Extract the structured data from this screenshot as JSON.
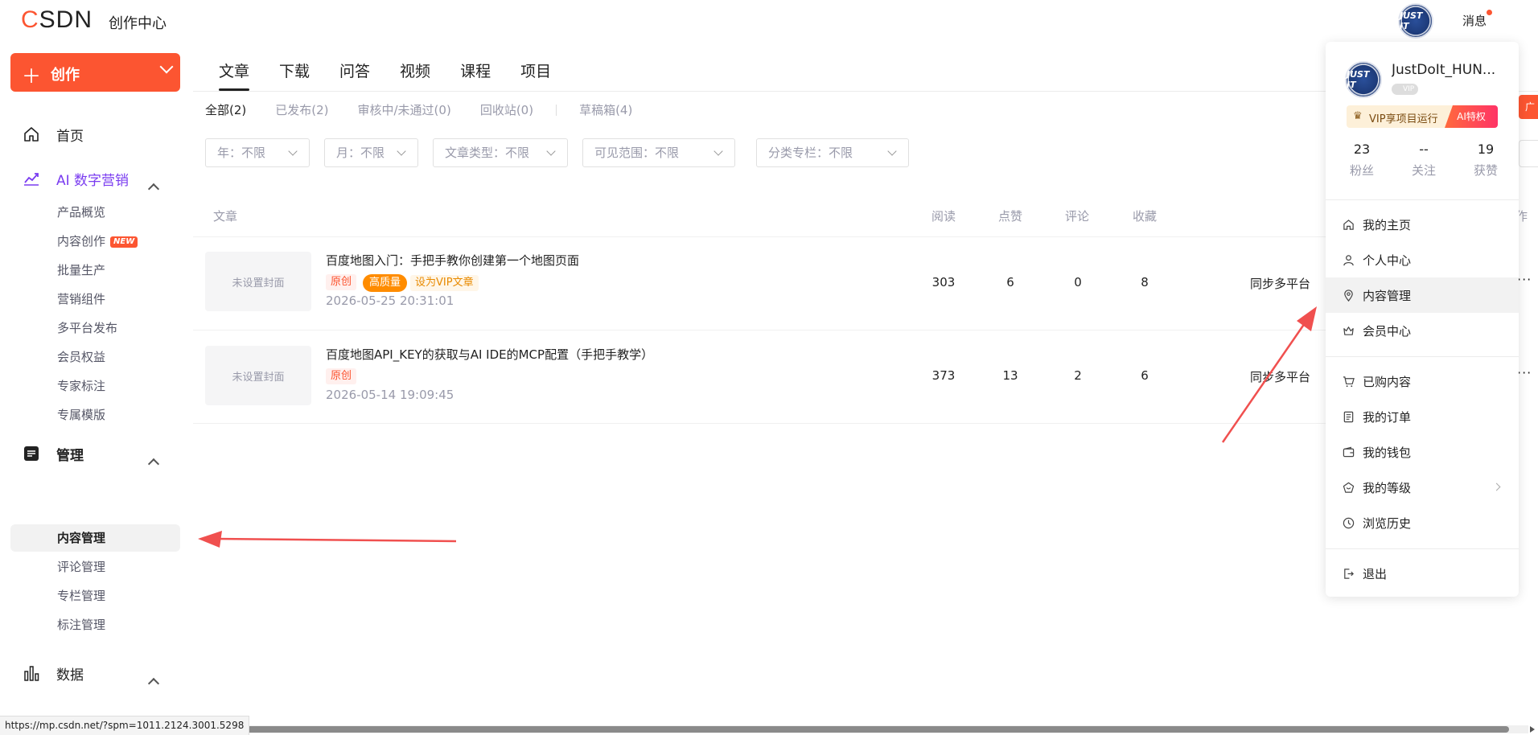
{
  "header": {
    "logo_prefix": "C",
    "logo_rest": "SDN",
    "title": "创作中心",
    "messages_label": "消息",
    "avatar_text": "JUST IT"
  },
  "sidebar": {
    "create_label": "创作",
    "home_label": "首页",
    "ai_group_label": "AI 数字营销",
    "ai_items": [
      "产品概览",
      "内容创作",
      "批量生产",
      "营销组件",
      "多平台发布",
      "会员权益",
      "专家标注",
      "专属模版"
    ],
    "new_badge": "NEW",
    "manage_group_label": "管理",
    "manage_items": [
      "内容管理",
      "评论管理",
      "专栏管理",
      "标注管理"
    ],
    "data_group_label": "数据"
  },
  "tabs": [
    "文章",
    "下载",
    "问答",
    "视频",
    "课程",
    "项目"
  ],
  "subtabs": [
    "全部(2)",
    "已发布(2)",
    "审核中/未通过(0)",
    "回收站(0)",
    "草稿箱(4)"
  ],
  "filters": [
    "年：不限",
    "月：不限",
    "文章类型：不限",
    "可见范围：不限",
    "分类专栏：不限"
  ],
  "table": {
    "headers": [
      "文章",
      "阅读",
      "点赞",
      "评论",
      "收藏"
    ],
    "right_header_fragment": "作",
    "rows": [
      {
        "cover": "未设置封面",
        "title": "百度地图入门：手把手教你创建第一个地图页面",
        "tag_original": "原创",
        "tag_quality": "高质量",
        "tag_vip": "设为VIP文章",
        "time": "2026-05-25 20:31:01",
        "reads": "303",
        "likes": "6",
        "comments": "0",
        "favorites": "8",
        "sync": "同步多平台",
        "more": "···"
      },
      {
        "cover": "未设置封面",
        "title": "百度地图API_KEY的获取与AI IDE的MCP配置（手把手教学）",
        "tag_original": "原创",
        "time": "2026-05-14 19:09:45",
        "reads": "373",
        "likes": "13",
        "comments": "2",
        "favorites": "6",
        "sync": "同步多平台",
        "more": "···"
      }
    ]
  },
  "promo_corner": "广",
  "user_panel": {
    "name": "JustDoIt_HUN...",
    "vip_badge": "VIP",
    "vip_promo": "VIP享项目运行",
    "vip_ai": "AI特权",
    "stats": [
      {
        "value": "23",
        "label": "粉丝"
      },
      {
        "value": "--",
        "label": "关注"
      },
      {
        "value": "19",
        "label": "获赞"
      }
    ],
    "menu_primary": [
      "我的主页",
      "个人中心",
      "内容管理",
      "会员中心"
    ],
    "menu_secondary": [
      "已购内容",
      "我的订单",
      "我的钱包",
      "我的等级",
      "浏览历史"
    ],
    "logout": "退出"
  },
  "status_url": "https://mp.csdn.net/?spm=1011.2124.3001.5298",
  "colors": {
    "brand": "#fc5531",
    "ai_purple": "#7a3cf0",
    "annotation_arrow": "#f0504f"
  }
}
